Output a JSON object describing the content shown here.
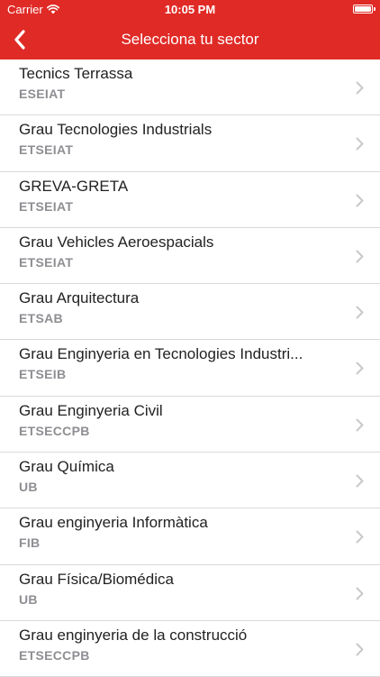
{
  "colors": {
    "accent": "#e02a26",
    "chevron": "#c7c7cc"
  },
  "status_bar": {
    "carrier": "Carrier",
    "time": "10:05 PM",
    "battery_level": 1.0
  },
  "nav": {
    "title": "Selecciona tu sector",
    "back_icon": "chevron-left-icon"
  },
  "sectors": [
    {
      "title": "Tecnics Terrassa",
      "subtitle": "ESEIAT"
    },
    {
      "title": "Grau Tecnologies Industrials",
      "subtitle": "ETSEIAT"
    },
    {
      "title": "GREVA-GRETA",
      "subtitle": "ETSEIAT"
    },
    {
      "title": "Grau Vehicles Aeroespacials",
      "subtitle": "ETSEIAT"
    },
    {
      "title": "Grau Arquitectura",
      "subtitle": "ETSAB"
    },
    {
      "title": "Grau Enginyeria en Tecnologies Industri...",
      "subtitle": "ETSEIB"
    },
    {
      "title": "Grau Enginyeria Civil",
      "subtitle": "ETSECCPB"
    },
    {
      "title": "Grau Química",
      "subtitle": "UB"
    },
    {
      "title": "Grau enginyeria Informàtica",
      "subtitle": "FIB"
    },
    {
      "title": "Grau Física/Biomédica",
      "subtitle": "UB"
    },
    {
      "title": "Grau enginyeria de la construcció",
      "subtitle": "ETSECCPB"
    }
  ]
}
